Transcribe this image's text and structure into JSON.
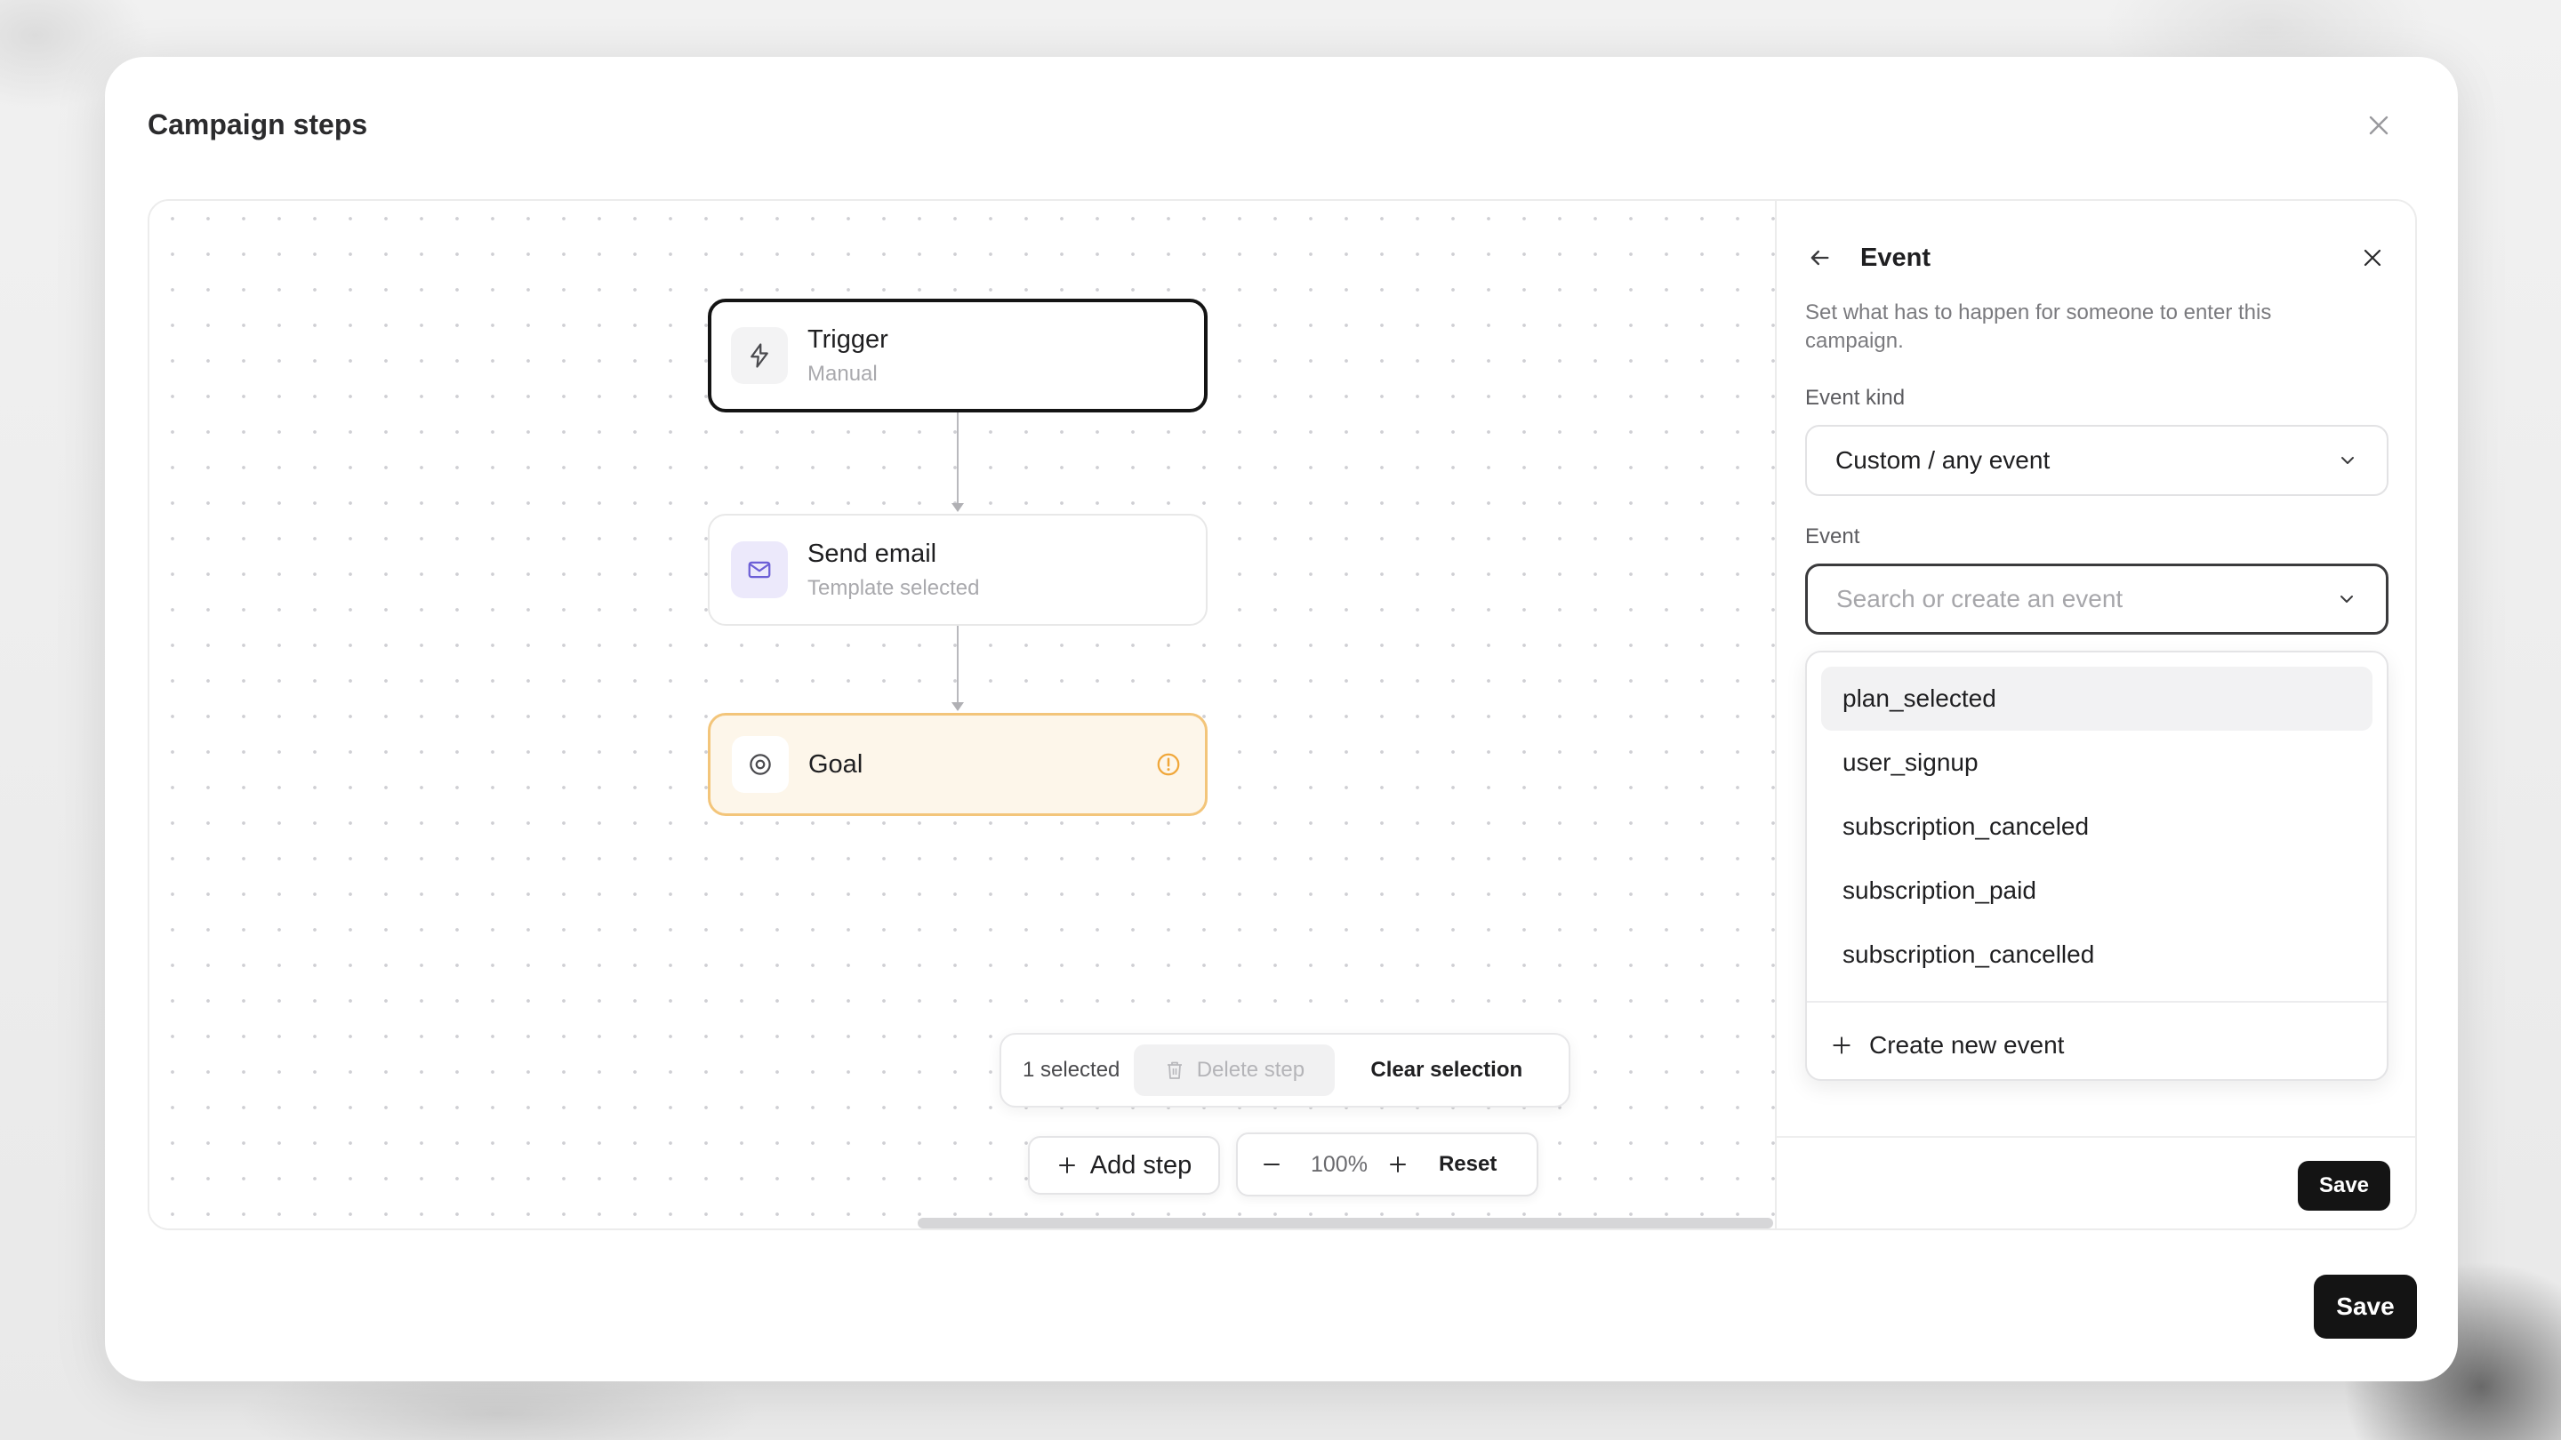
{
  "modal": {
    "title": "Campaign steps",
    "save_label": "Save"
  },
  "canvas": {
    "nodes": [
      {
        "title": "Trigger",
        "subtitle": "Manual",
        "icon": "lightning-icon"
      },
      {
        "title": "Send email",
        "subtitle": "Template selected",
        "icon": "mail-icon"
      },
      {
        "title": "Goal",
        "subtitle": "",
        "icon": "target-icon",
        "status_icon": "warning-icon"
      }
    ],
    "selection_bar": {
      "count_label": "1 selected",
      "delete_label": "Delete step",
      "clear_label": "Clear selection"
    },
    "toolbar": {
      "add_step_label": "Add step",
      "zoom_value": "100%",
      "reset_label": "Reset"
    }
  },
  "panel": {
    "title": "Event",
    "description": "Set what has to happen for someone to enter this campaign.",
    "event_kind": {
      "label": "Event kind",
      "value": "Custom / any event"
    },
    "event": {
      "label": "Event",
      "placeholder": "Search or create an event",
      "options": [
        "plan_selected",
        "user_signup",
        "subscription_canceled",
        "subscription_paid",
        "subscription_cancelled"
      ],
      "create_label": "Create new event"
    },
    "save_label": "Save"
  },
  "colors": {
    "accent_dark": "#141414",
    "goal_border": "#f3c57a",
    "goal_background": "#fdf6ea",
    "warning": "#f0a73a",
    "email_icon": "#6c5fd6"
  }
}
